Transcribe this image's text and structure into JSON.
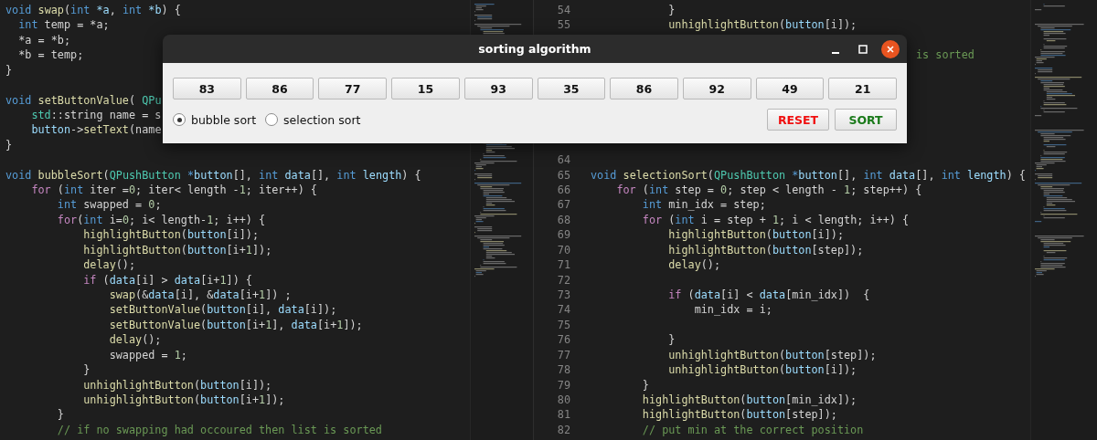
{
  "editor": {
    "left_pane": {
      "lines": [
        {
          "kind": "code",
          "t": [
            {
              "kind": "keyword",
              "text": "void"
            },
            {
              "kind": "function",
              "text": " swap"
            },
            {
              "kind": "plain",
              "text": "("
            },
            {
              "kind": "keyword",
              "text": "int"
            },
            {
              "kind": "variable",
              "text": " *a"
            },
            {
              "kind": "plain",
              "text": ", "
            },
            {
              "kind": "keyword",
              "text": "int"
            },
            {
              "kind": "variable",
              "text": " *b"
            },
            {
              "kind": "plain",
              "text": ") {"
            }
          ]
        },
        {
          "kind": "code",
          "t": [
            {
              "kind": "keyword",
              "text": "  int"
            },
            {
              "kind": "plain",
              "text": " temp = *a;"
            }
          ]
        },
        {
          "kind": "code",
          "t": [
            {
              "kind": "plain",
              "text": "  *a = *b;"
            }
          ]
        },
        {
          "kind": "code",
          "t": [
            {
              "kind": "plain",
              "text": "  *b = temp;"
            }
          ]
        },
        {
          "kind": "code",
          "t": [
            {
              "kind": "plain",
              "text": "}"
            }
          ]
        },
        {
          "kind": "blank"
        },
        {
          "kind": "code",
          "t": [
            {
              "kind": "keyword",
              "text": "void"
            },
            {
              "kind": "function",
              "text": " setButtonValue"
            },
            {
              "kind": "plain",
              "text": "( "
            },
            {
              "kind": "type",
              "text": "QPu"
            }
          ]
        },
        {
          "kind": "code",
          "t": [
            {
              "kind": "type",
              "text": "    std"
            },
            {
              "kind": "plain",
              "text": "::string name = s"
            }
          ]
        },
        {
          "kind": "code",
          "t": [
            {
              "kind": "variable",
              "text": "    button"
            },
            {
              "kind": "plain",
              "text": "->"
            },
            {
              "kind": "function",
              "text": "setText"
            },
            {
              "kind": "plain",
              "text": "(name"
            }
          ]
        },
        {
          "kind": "code",
          "t": [
            {
              "kind": "plain",
              "text": "}"
            }
          ]
        },
        {
          "kind": "blank"
        },
        {
          "kind": "code",
          "t": [
            {
              "kind": "keyword",
              "text": "void"
            },
            {
              "kind": "function",
              "text": " bubbleSort"
            },
            {
              "kind": "plain",
              "text": "("
            },
            {
              "kind": "type",
              "text": "QPushButton"
            },
            {
              "kind": "keyword",
              "text": " *"
            },
            {
              "kind": "variable",
              "text": "button"
            },
            {
              "kind": "plain",
              "text": "[], "
            },
            {
              "kind": "keyword",
              "text": "int"
            },
            {
              "kind": "variable",
              "text": " data"
            },
            {
              "kind": "plain",
              "text": "[], "
            },
            {
              "kind": "keyword",
              "text": "int"
            },
            {
              "kind": "variable",
              "text": " length"
            },
            {
              "kind": "plain",
              "text": ") {"
            }
          ]
        },
        {
          "kind": "code",
          "t": [
            {
              "kind": "control",
              "text": "    for"
            },
            {
              "kind": "plain",
              "text": " ("
            },
            {
              "kind": "keyword",
              "text": "int"
            },
            {
              "kind": "plain",
              "text": " iter ="
            },
            {
              "kind": "number",
              "text": "0"
            },
            {
              "kind": "plain",
              "text": "; iter< length -"
            },
            {
              "kind": "number",
              "text": "1"
            },
            {
              "kind": "plain",
              "text": "; iter++) {"
            }
          ]
        },
        {
          "kind": "code",
          "t": [
            {
              "kind": "keyword",
              "text": "        int"
            },
            {
              "kind": "plain",
              "text": " swapped = "
            },
            {
              "kind": "number",
              "text": "0"
            },
            {
              "kind": "plain",
              "text": ";"
            }
          ]
        },
        {
          "kind": "code",
          "t": [
            {
              "kind": "control",
              "text": "        for"
            },
            {
              "kind": "plain",
              "text": "("
            },
            {
              "kind": "keyword",
              "text": "int"
            },
            {
              "kind": "plain",
              "text": " i="
            },
            {
              "kind": "number",
              "text": "0"
            },
            {
              "kind": "plain",
              "text": "; i< length-"
            },
            {
              "kind": "number",
              "text": "1"
            },
            {
              "kind": "plain",
              "text": "; i++) {"
            }
          ]
        },
        {
          "kind": "code",
          "t": [
            {
              "kind": "function",
              "text": "            highlightButton"
            },
            {
              "kind": "plain",
              "text": "("
            },
            {
              "kind": "variable",
              "text": "button"
            },
            {
              "kind": "plain",
              "text": "[i]);"
            }
          ]
        },
        {
          "kind": "code",
          "t": [
            {
              "kind": "function",
              "text": "            highlightButton"
            },
            {
              "kind": "plain",
              "text": "("
            },
            {
              "kind": "variable",
              "text": "button"
            },
            {
              "kind": "plain",
              "text": "[i+"
            },
            {
              "kind": "number",
              "text": "1"
            },
            {
              "kind": "plain",
              "text": "]);"
            }
          ]
        },
        {
          "kind": "code",
          "t": [
            {
              "kind": "function",
              "text": "            delay"
            },
            {
              "kind": "plain",
              "text": "();"
            }
          ]
        },
        {
          "kind": "code",
          "t": [
            {
              "kind": "control",
              "text": "            if"
            },
            {
              "kind": "plain",
              "text": " ("
            },
            {
              "kind": "variable",
              "text": "data"
            },
            {
              "kind": "plain",
              "text": "[i] > "
            },
            {
              "kind": "variable",
              "text": "data"
            },
            {
              "kind": "plain",
              "text": "[i+"
            },
            {
              "kind": "number",
              "text": "1"
            },
            {
              "kind": "plain",
              "text": "]) {"
            }
          ]
        },
        {
          "kind": "code",
          "t": [
            {
              "kind": "function",
              "text": "                swap"
            },
            {
              "kind": "plain",
              "text": "(&"
            },
            {
              "kind": "variable",
              "text": "data"
            },
            {
              "kind": "plain",
              "text": "[i], &"
            },
            {
              "kind": "variable",
              "text": "data"
            },
            {
              "kind": "plain",
              "text": "[i+"
            },
            {
              "kind": "number",
              "text": "1"
            },
            {
              "kind": "plain",
              "text": "]) ;"
            }
          ]
        },
        {
          "kind": "code",
          "t": [
            {
              "kind": "function",
              "text": "                setButtonValue"
            },
            {
              "kind": "plain",
              "text": "("
            },
            {
              "kind": "variable",
              "text": "button"
            },
            {
              "kind": "plain",
              "text": "[i], "
            },
            {
              "kind": "variable",
              "text": "data"
            },
            {
              "kind": "plain",
              "text": "[i]);"
            }
          ]
        },
        {
          "kind": "code",
          "t": [
            {
              "kind": "function",
              "text": "                setButtonValue"
            },
            {
              "kind": "plain",
              "text": "("
            },
            {
              "kind": "variable",
              "text": "button"
            },
            {
              "kind": "plain",
              "text": "[i+"
            },
            {
              "kind": "number",
              "text": "1"
            },
            {
              "kind": "plain",
              "text": "], "
            },
            {
              "kind": "variable",
              "text": "data"
            },
            {
              "kind": "plain",
              "text": "[i+"
            },
            {
              "kind": "number",
              "text": "1"
            },
            {
              "kind": "plain",
              "text": "]);"
            }
          ]
        },
        {
          "kind": "code",
          "t": [
            {
              "kind": "function",
              "text": "                delay"
            },
            {
              "kind": "plain",
              "text": "();"
            }
          ]
        },
        {
          "kind": "code",
          "t": [
            {
              "kind": "plain",
              "text": "                swapped = "
            },
            {
              "kind": "number",
              "text": "1"
            },
            {
              "kind": "plain",
              "text": ";"
            }
          ]
        },
        {
          "kind": "code",
          "t": [
            {
              "kind": "plain",
              "text": "            }"
            }
          ]
        },
        {
          "kind": "code",
          "t": [
            {
              "kind": "function",
              "text": "            unhighlightButton"
            },
            {
              "kind": "plain",
              "text": "("
            },
            {
              "kind": "variable",
              "text": "button"
            },
            {
              "kind": "plain",
              "text": "[i]);"
            }
          ]
        },
        {
          "kind": "code",
          "t": [
            {
              "kind": "function",
              "text": "            unhighlightButton"
            },
            {
              "kind": "plain",
              "text": "("
            },
            {
              "kind": "variable",
              "text": "button"
            },
            {
              "kind": "plain",
              "text": "[i+"
            },
            {
              "kind": "number",
              "text": "1"
            },
            {
              "kind": "plain",
              "text": "]);"
            }
          ]
        },
        {
          "kind": "code",
          "t": [
            {
              "kind": "plain",
              "text": "        }"
            }
          ]
        },
        {
          "kind": "code",
          "t": [
            {
              "kind": "comment",
              "text": "        // if no swapping had occoured then list is sorted"
            }
          ]
        }
      ]
    },
    "right_pane": {
      "lines": [
        {
          "kind": "code",
          "n": "54",
          "t": [
            {
              "kind": "plain",
              "text": "            }"
            }
          ]
        },
        {
          "kind": "code",
          "n": "55",
          "t": [
            {
              "kind": "function",
              "text": "            unhighlightButton"
            },
            {
              "kind": "plain",
              "text": "("
            },
            {
              "kind": "variable",
              "text": "button"
            },
            {
              "kind": "plain",
              "text": "[i]);"
            }
          ]
        },
        {
          "kind": "blank"
        },
        {
          "kind": "clipped",
          "t": [
            {
              "kind": "comment",
              "text": "is sorted"
            }
          ]
        },
        {
          "kind": "blank"
        },
        {
          "kind": "blank"
        },
        {
          "kind": "blank"
        },
        {
          "kind": "blank"
        },
        {
          "kind": "blank"
        },
        {
          "kind": "blank"
        },
        {
          "kind": "blank",
          "n": "64"
        },
        {
          "kind": "code",
          "n": "65",
          "t": [
            {
              "kind": "keyword",
              "text": "void"
            },
            {
              "kind": "function",
              "text": " selectionSort"
            },
            {
              "kind": "plain",
              "text": "("
            },
            {
              "kind": "type",
              "text": "QPushButton"
            },
            {
              "kind": "keyword",
              "text": " *"
            },
            {
              "kind": "variable",
              "text": "button"
            },
            {
              "kind": "plain",
              "text": "[], "
            },
            {
              "kind": "keyword",
              "text": "int"
            },
            {
              "kind": "variable",
              "text": " data"
            },
            {
              "kind": "plain",
              "text": "[], "
            },
            {
              "kind": "keyword",
              "text": "int"
            },
            {
              "kind": "variable",
              "text": " length"
            },
            {
              "kind": "plain",
              "text": ") {"
            }
          ]
        },
        {
          "kind": "code",
          "n": "66",
          "t": [
            {
              "kind": "control",
              "text": "    for"
            },
            {
              "kind": "plain",
              "text": " ("
            },
            {
              "kind": "keyword",
              "text": "int"
            },
            {
              "kind": "plain",
              "text": " step = "
            },
            {
              "kind": "number",
              "text": "0"
            },
            {
              "kind": "plain",
              "text": "; step < length - "
            },
            {
              "kind": "number",
              "text": "1"
            },
            {
              "kind": "plain",
              "text": "; step++) {"
            }
          ]
        },
        {
          "kind": "code",
          "n": "67",
          "t": [
            {
              "kind": "keyword",
              "text": "        int"
            },
            {
              "kind": "plain",
              "text": " min_idx = step;"
            }
          ]
        },
        {
          "kind": "code",
          "n": "68",
          "t": [
            {
              "kind": "control",
              "text": "        for"
            },
            {
              "kind": "plain",
              "text": " ("
            },
            {
              "kind": "keyword",
              "text": "int"
            },
            {
              "kind": "plain",
              "text": " i = step + "
            },
            {
              "kind": "number",
              "text": "1"
            },
            {
              "kind": "plain",
              "text": "; i < length; i++) {"
            }
          ]
        },
        {
          "kind": "code",
          "n": "69",
          "t": [
            {
              "kind": "function",
              "text": "            highlightButton"
            },
            {
              "kind": "plain",
              "text": "("
            },
            {
              "kind": "variable",
              "text": "button"
            },
            {
              "kind": "plain",
              "text": "[i]);"
            }
          ]
        },
        {
          "kind": "code",
          "n": "70",
          "t": [
            {
              "kind": "function",
              "text": "            highlightButton"
            },
            {
              "kind": "plain",
              "text": "("
            },
            {
              "kind": "variable",
              "text": "button"
            },
            {
              "kind": "plain",
              "text": "[step]);"
            }
          ]
        },
        {
          "kind": "code",
          "n": "71",
          "t": [
            {
              "kind": "function",
              "text": "            delay"
            },
            {
              "kind": "plain",
              "text": "();"
            }
          ]
        },
        {
          "kind": "blank",
          "n": "72"
        },
        {
          "kind": "code",
          "n": "73",
          "t": [
            {
              "kind": "control",
              "text": "            if"
            },
            {
              "kind": "plain",
              "text": " ("
            },
            {
              "kind": "variable",
              "text": "data"
            },
            {
              "kind": "plain",
              "text": "[i] < "
            },
            {
              "kind": "variable",
              "text": "data"
            },
            {
              "kind": "plain",
              "text": "[min_idx])  {"
            }
          ]
        },
        {
          "kind": "code",
          "n": "74",
          "t": [
            {
              "kind": "plain",
              "text": "                min_idx = i;"
            }
          ]
        },
        {
          "kind": "blank",
          "n": "75"
        },
        {
          "kind": "code",
          "n": "76",
          "t": [
            {
              "kind": "plain",
              "text": "            }"
            }
          ]
        },
        {
          "kind": "code",
          "n": "77",
          "t": [
            {
              "kind": "function",
              "text": "            unhighlightButton"
            },
            {
              "kind": "plain",
              "text": "("
            },
            {
              "kind": "variable",
              "text": "button"
            },
            {
              "kind": "plain",
              "text": "[step]);"
            }
          ]
        },
        {
          "kind": "code",
          "n": "78",
          "t": [
            {
              "kind": "function",
              "text": "            unhighlightButton"
            },
            {
              "kind": "plain",
              "text": "("
            },
            {
              "kind": "variable",
              "text": "button"
            },
            {
              "kind": "plain",
              "text": "[i]);"
            }
          ]
        },
        {
          "kind": "code",
          "n": "79",
          "t": [
            {
              "kind": "plain",
              "text": "        }"
            }
          ]
        },
        {
          "kind": "code",
          "n": "80",
          "t": [
            {
              "kind": "function",
              "text": "        highlightButton"
            },
            {
              "kind": "plain",
              "text": "("
            },
            {
              "kind": "variable",
              "text": "button"
            },
            {
              "kind": "plain",
              "text": "[min_idx]);"
            }
          ]
        },
        {
          "kind": "code",
          "n": "81",
          "t": [
            {
              "kind": "function",
              "text": "        highlightButton"
            },
            {
              "kind": "plain",
              "text": "("
            },
            {
              "kind": "variable",
              "text": "button"
            },
            {
              "kind": "plain",
              "text": "[step]);"
            }
          ]
        },
        {
          "kind": "code",
          "n": "82",
          "t": [
            {
              "kind": "comment",
              "text": "        // put min at the correct position"
            }
          ]
        }
      ]
    }
  },
  "dialog": {
    "title": "sorting algorithm",
    "values": [
      "83",
      "86",
      "77",
      "15",
      "93",
      "35",
      "86",
      "92",
      "49",
      "21"
    ],
    "algorithms": [
      {
        "label": "bubble sort",
        "selected": true
      },
      {
        "label": "selection sort",
        "selected": false
      }
    ],
    "buttons": [
      {
        "label": "RESET",
        "kind": "reset"
      },
      {
        "label": "SORT",
        "kind": "sort"
      }
    ]
  }
}
